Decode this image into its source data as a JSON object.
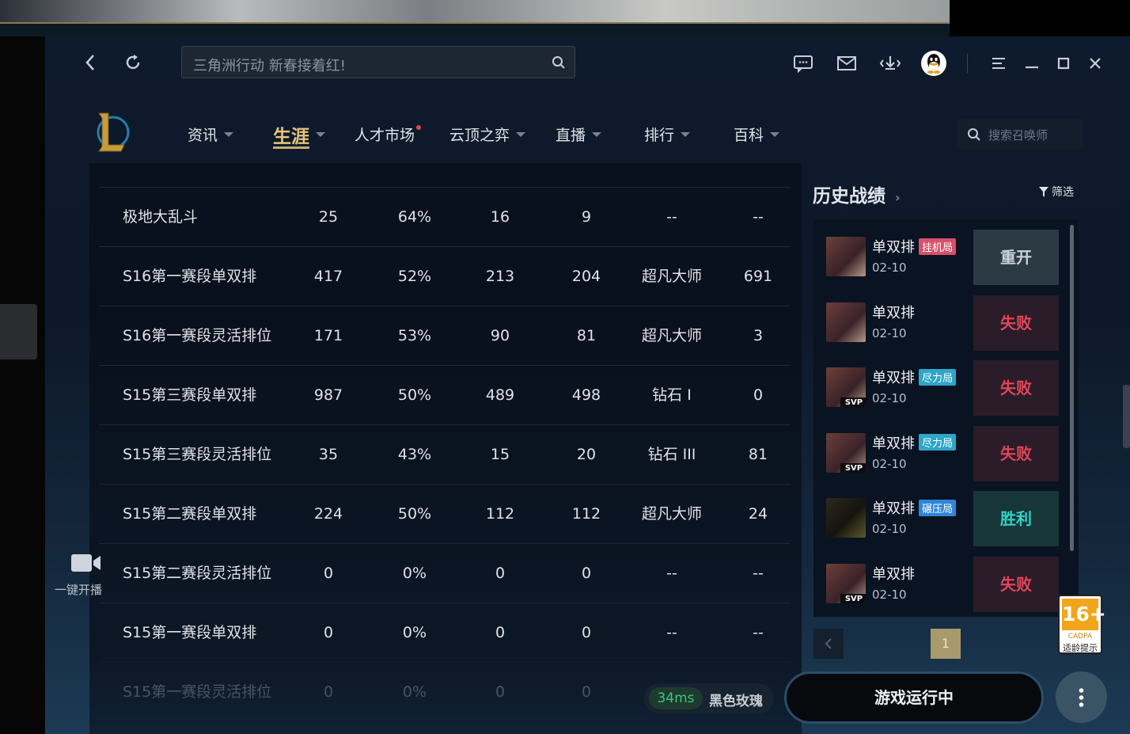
{
  "titlebar": {
    "search_placeholder": "三角洲行动 新春接着红!",
    "icons": [
      "back-icon",
      "refresh-icon",
      "search-icon",
      "chat-icon",
      "mail-icon",
      "download-icon",
      "qq-avatar-icon",
      "menu-icon",
      "minimize-icon",
      "maximize-icon",
      "close-icon"
    ]
  },
  "nav": {
    "items": [
      {
        "label": "资讯",
        "caret": true
      },
      {
        "label": "生涯",
        "caret": true,
        "active": true
      },
      {
        "label": "人才市场",
        "caret": false,
        "dot": true
      },
      {
        "label": "云顶之弈",
        "caret": true
      },
      {
        "label": "直播",
        "caret": true
      },
      {
        "label": "排行",
        "caret": true
      },
      {
        "label": "百科",
        "caret": true
      }
    ],
    "summoner_search_placeholder": "搜索召唤师"
  },
  "stats_table": {
    "rows": [
      [
        "极地大乱斗",
        "25",
        "64%",
        "16",
        "9",
        "--",
        "--"
      ],
      [
        "S16第一赛段单双排",
        "417",
        "52%",
        "213",
        "204",
        "超凡大师",
        "691"
      ],
      [
        "S16第一赛段灵活排位",
        "171",
        "53%",
        "90",
        "81",
        "超凡大师",
        "3"
      ],
      [
        "S15第三赛段单双排",
        "987",
        "50%",
        "489",
        "498",
        "钻石 I",
        "0"
      ],
      [
        "S15第三赛段灵活排位",
        "35",
        "43%",
        "15",
        "20",
        "钻石 III",
        "81"
      ],
      [
        "S15第二赛段单双排",
        "224",
        "50%",
        "112",
        "112",
        "超凡大师",
        "24"
      ],
      [
        "S15第二赛段灵活排位",
        "0",
        "0%",
        "0",
        "0",
        "--",
        "--"
      ],
      [
        "S15第一赛段单双排",
        "0",
        "0%",
        "0",
        "0",
        "--",
        "--"
      ],
      [
        "S15第一赛段灵活排位",
        "0",
        "0%",
        "0",
        "0",
        "--",
        "--"
      ]
    ]
  },
  "stream": {
    "label": "一键开播"
  },
  "history": {
    "title": "历史战绩",
    "filter_label": "筛选",
    "items": [
      {
        "mode": "单双排",
        "tag": "挂机局",
        "tag_color": "#d94f6b",
        "date": "02-10",
        "result": "重开",
        "result_color": "#c9d2d6",
        "bg": "#2c3a44",
        "svp": false
      },
      {
        "mode": "单双排",
        "tag": "",
        "tag_color": "",
        "date": "02-10",
        "result": "失败",
        "result_color": "#e0455a",
        "bg": "#2a1c28",
        "svp": false
      },
      {
        "mode": "单双排",
        "tag": "尽力局",
        "tag_color": "#2ea6c8",
        "date": "02-10",
        "result": "失败",
        "result_color": "#e0455a",
        "bg": "#2a1c28",
        "svp": true
      },
      {
        "mode": "单双排",
        "tag": "尽力局",
        "tag_color": "#2ea6c8",
        "date": "02-10",
        "result": "失败",
        "result_color": "#e0455a",
        "bg": "#2a1c28",
        "svp": true
      },
      {
        "mode": "单双排",
        "tag": "碾压局",
        "tag_color": "#2f86d8",
        "date": "02-10",
        "result": "胜利",
        "result_color": "#33d2c8",
        "bg": "#163638",
        "svp": false
      },
      {
        "mode": "单双排",
        "tag": "",
        "tag_color": "",
        "date": "02-10",
        "result": "失败",
        "result_color": "#e0455a",
        "bg": "#2a1c28",
        "svp": true
      }
    ],
    "page": "1"
  },
  "bottom": {
    "ping": "34ms",
    "server": "黑色玫瑰",
    "launch_label": "游戏运行中"
  },
  "rating_badge": {
    "age": "16+",
    "org": "CADPA",
    "note": "适龄提示"
  }
}
